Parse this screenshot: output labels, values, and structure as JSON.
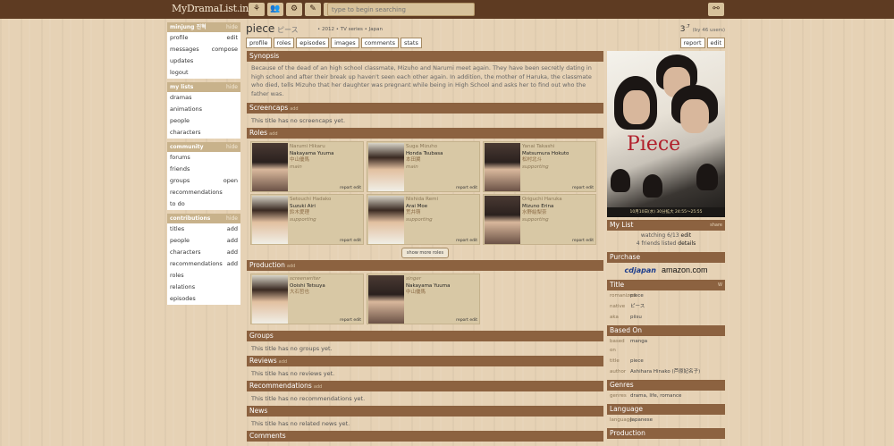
{
  "topbar": {
    "logo": "MyDramaList.info",
    "icons": [
      "⚘",
      "👥",
      "⚙",
      "✎",
      "⚑"
    ],
    "search_placeholder": "type to begin searching",
    "link_icon": "⚯"
  },
  "sidebar": {
    "user": {
      "header": "minjung 진혁",
      "toggle": "hide",
      "items": [
        [
          "profile",
          "edit"
        ],
        [
          "messages",
          "compose"
        ],
        [
          "updates",
          ""
        ],
        [
          "logout",
          ""
        ]
      ]
    },
    "lists": {
      "header": "my lists",
      "toggle": "hide",
      "items": [
        [
          "dramas",
          ""
        ],
        [
          "animations",
          ""
        ],
        [
          "people",
          ""
        ],
        [
          "characters",
          ""
        ]
      ]
    },
    "community": {
      "header": "community",
      "toggle": "hide",
      "items": [
        [
          "forums",
          ""
        ],
        [
          "friends",
          ""
        ],
        [
          "groups",
          "open"
        ],
        [
          "recommendations",
          ""
        ],
        [
          "to do",
          ""
        ]
      ]
    },
    "contributions": {
      "header": "contributions",
      "toggle": "hide",
      "items": [
        [
          "titles",
          "add"
        ],
        [
          "people",
          "add"
        ],
        [
          "characters",
          "add"
        ],
        [
          "recommendations",
          "add"
        ],
        [
          "roles",
          ""
        ],
        [
          "relations",
          ""
        ],
        [
          "episodes",
          ""
        ]
      ]
    }
  },
  "header": {
    "title": "piece",
    "native": "ピース",
    "meta": "• 2012  • TV series  • Japan",
    "rating": "3",
    "rating_sup": ".7",
    "rating_users": "(by 46 users)",
    "tabs": [
      "profile",
      "roles",
      "episodes",
      "images",
      "comments",
      "stats"
    ],
    "right_tabs": [
      "report",
      "edit"
    ]
  },
  "main": {
    "synopsis_title": "Synopsis",
    "synopsis": "Because of the dead of an high school classmate, Mizuho and Narumi meet again. They have been secretly dating in high school and after their break up haven't seen each other again. In addition, the mother of Haruka, the classmate who died, tells Mizuho that her daughter was pregnant while being in High School and asks her to find out who the father was.",
    "screencaps_title": "Screencaps",
    "screencaps_empty": "This title has no screencaps yet.",
    "roles_title": "Roles",
    "add": "add",
    "roles": [
      {
        "char": "Narumi Hikaru",
        "actor": "Nakayama Yuuma",
        "native": "中山優馬",
        "type": "main",
        "tone": "dark"
      },
      {
        "char": "Suga Mizuho",
        "actor": "Honda Tsubasa",
        "native": "本田翼",
        "type": "main",
        "tone": "light"
      },
      {
        "char": "Yanai Takashi",
        "actor": "Matsumura Hokuto",
        "native": "松村北斗",
        "type": "supporting",
        "tone": "dark"
      },
      {
        "char": "Setouchi Hadako",
        "actor": "Suzuki Airi",
        "native": "鈴木愛理",
        "type": "supporting",
        "tone": "light"
      },
      {
        "char": "Nishida Remi",
        "actor": "Arai Moe",
        "native": "荒井萌",
        "type": "supporting",
        "tone": "light"
      },
      {
        "char": "Origuchi Haruka",
        "actor": "Mizuno Erina",
        "native": "水野絵梨奈",
        "type": "supporting",
        "tone": "dark"
      }
    ],
    "role_report": "report edit",
    "more_roles": "show more roles",
    "production_title": "Production",
    "production": [
      {
        "role": "screenwriter",
        "name": "Ooishi Tetsuya",
        "native": "大石哲也",
        "tone": "dark"
      },
      {
        "role": "singer",
        "name": "Nakayama Yuuma",
        "native": "中山優馬",
        "tone": "dark"
      }
    ],
    "groups_title": "Groups",
    "groups_empty": "This title has no groups yet.",
    "reviews_title": "Reviews",
    "reviews_empty": "This title has no reviews yet.",
    "recs_title": "Recommendations",
    "recs_empty": "This title has no recommendations yet.",
    "news_title": "News",
    "news_empty": "This title has no related news yet.",
    "comments_title": "Comments"
  },
  "right": {
    "poster_title": "Piece",
    "poster_banner": "10月10日(水) 30分拡大 24:55〜25:55",
    "mylist_title": "My List",
    "mylist_action": "share",
    "watching": "watching 6/13",
    "watching_edit": "edit",
    "friends": "4 friends listed",
    "friends_details": "details",
    "purchase_title": "Purchase",
    "yesasia": "cdjapan",
    "amazon": "amazon.com",
    "title_section": "Title",
    "title_w": "W",
    "title_rows": [
      [
        "romanized",
        "piece"
      ],
      [
        "native",
        "ピース"
      ],
      [
        "aka",
        "piisu"
      ]
    ],
    "based_title": "Based On",
    "based_rows": [
      [
        "based on",
        "manga"
      ],
      [
        "title",
        "piece"
      ],
      [
        "author",
        "Ashihara Hinako (芦原妃名子)"
      ]
    ],
    "genres_title": "Genres",
    "genres_rows": [
      [
        "genres",
        "drama, life, romance"
      ]
    ],
    "language_title": "Language",
    "language_rows": [
      [
        "language",
        "Japanese"
      ]
    ],
    "production_title": "Production"
  }
}
